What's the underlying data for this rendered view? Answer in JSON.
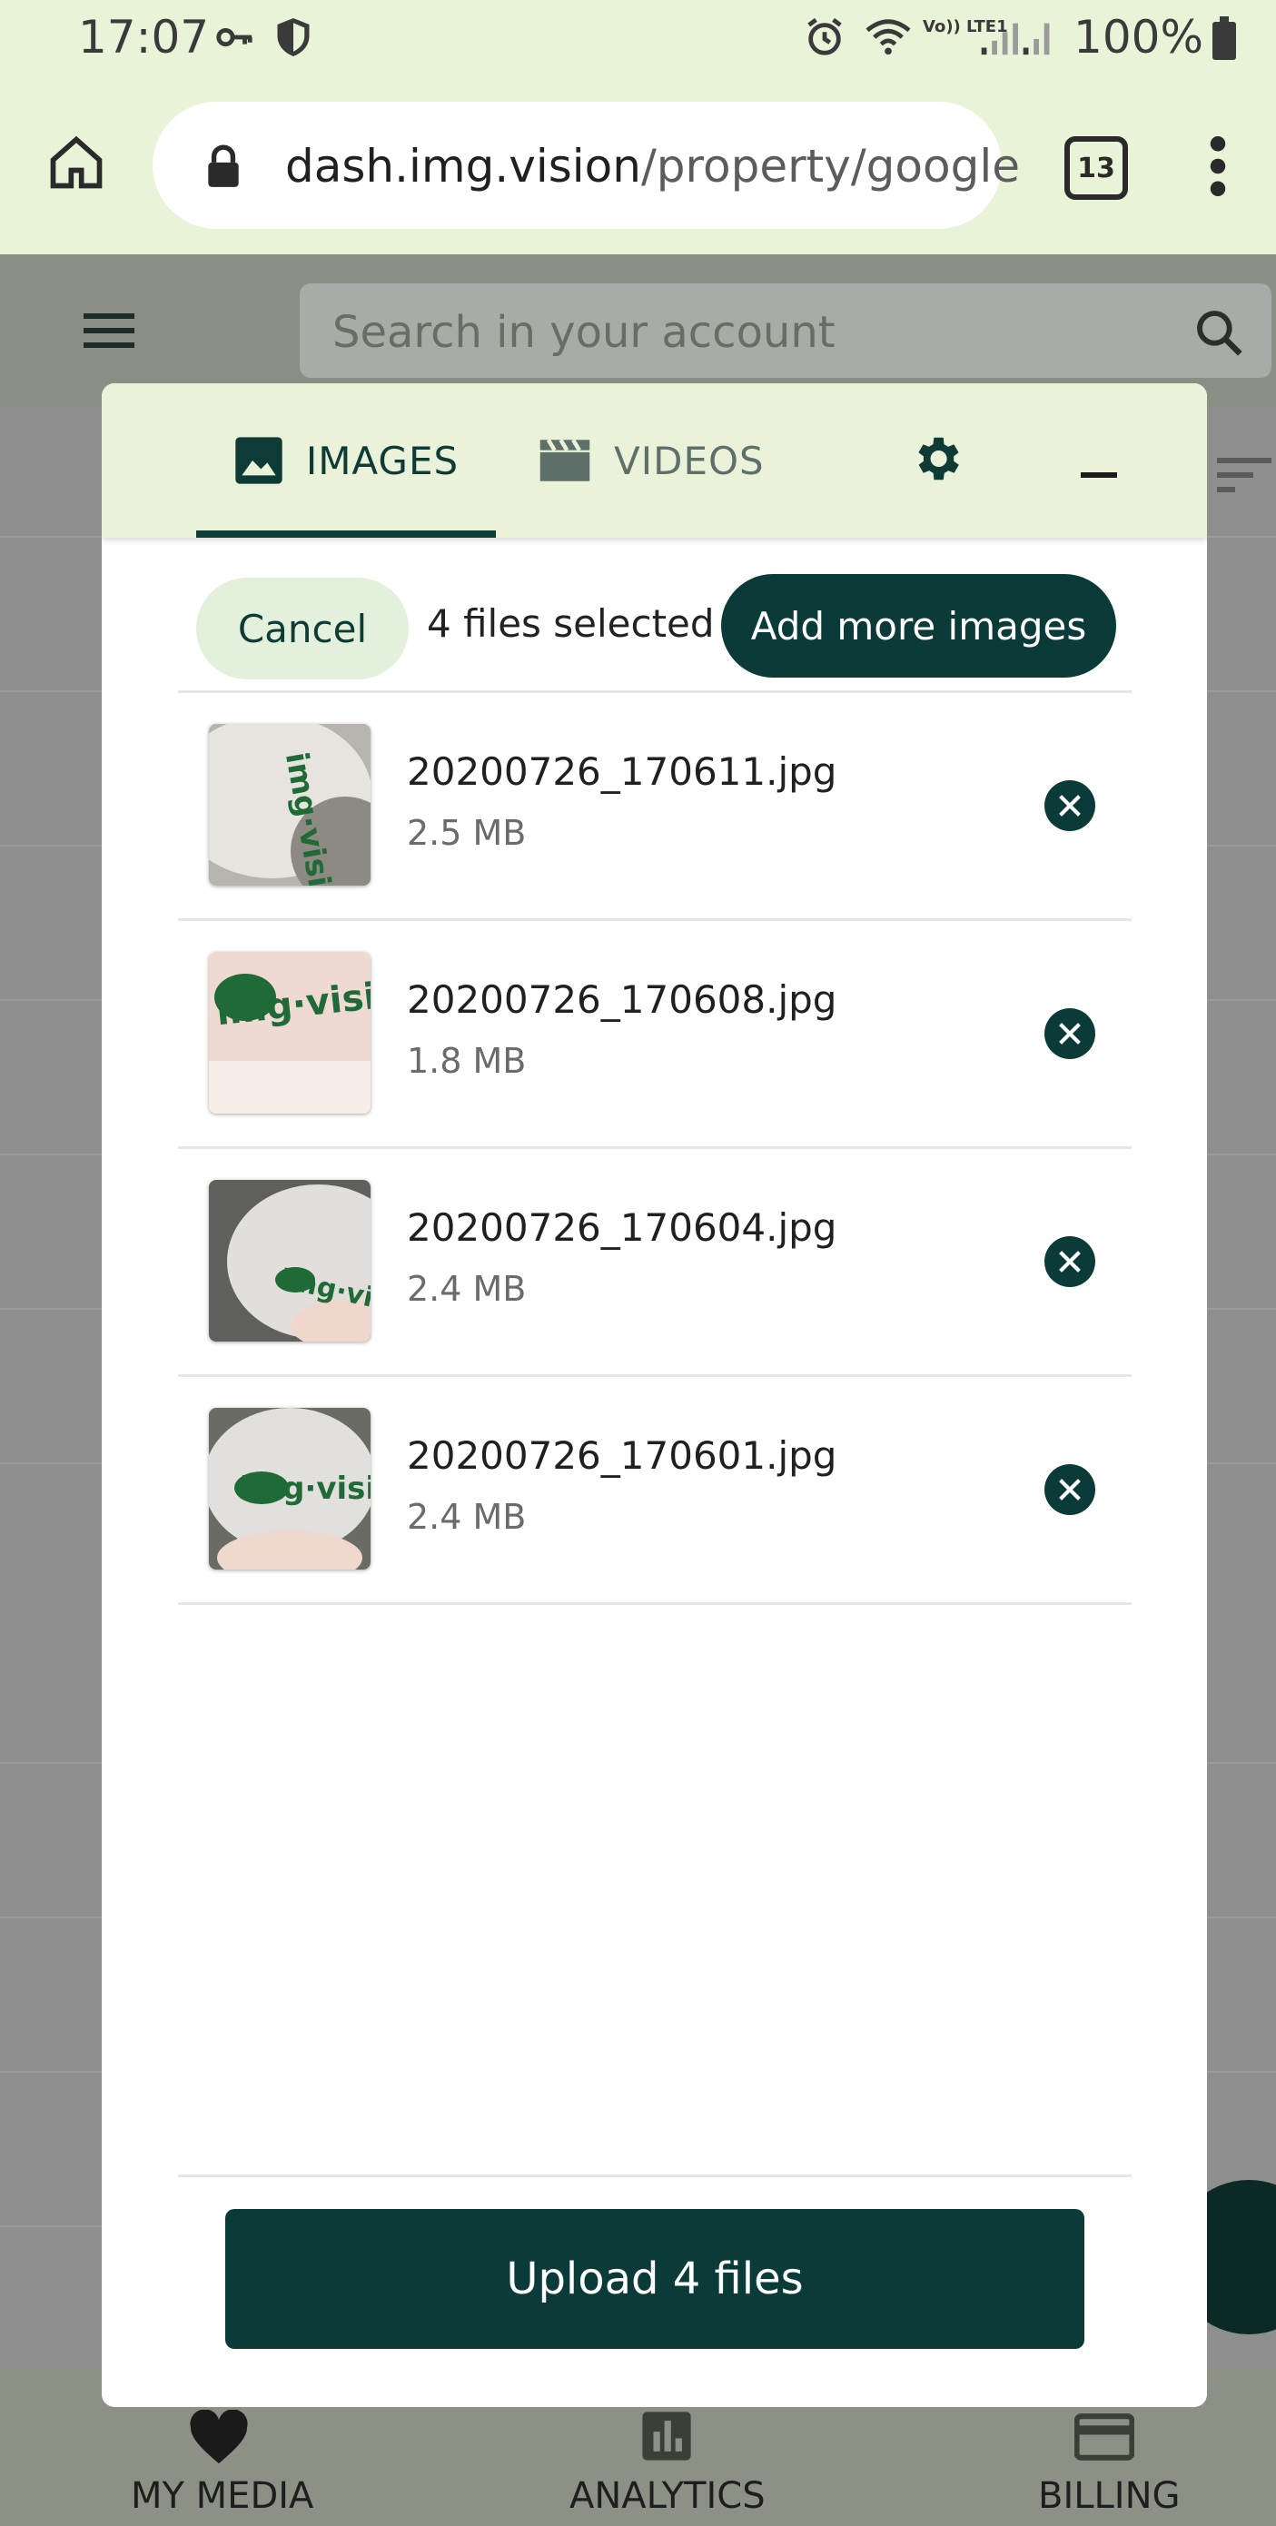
{
  "status_bar": {
    "time": "17:07",
    "battery": "100%",
    "network_label": "Vo)) LTE1",
    "icons": [
      "key-icon",
      "shield-icon",
      "alarm-icon",
      "wifi-icon",
      "signal-icon",
      "battery-icon"
    ]
  },
  "browser": {
    "url_host": "dash.img.vision",
    "url_path": "/property/google",
    "tab_count": "13",
    "icons": [
      "home-icon",
      "lock-icon",
      "tabs-icon",
      "more-vert-icon"
    ]
  },
  "app": {
    "search_placeholder": "Search in your account",
    "bottom_nav": [
      {
        "label": "MY MEDIA",
        "icon": "heart-icon"
      },
      {
        "label": "ANALYTICS",
        "icon": "bar-chart-icon"
      },
      {
        "label": "BILLING",
        "icon": "credit-card-icon"
      }
    ]
  },
  "upload_modal": {
    "tabs": [
      {
        "label": "IMAGES",
        "icon": "image-icon",
        "active": true
      },
      {
        "label": "VIDEOS",
        "icon": "movie-icon",
        "active": false
      }
    ],
    "cancel_label": "Cancel",
    "selected_text": "4 files selected",
    "add_more_label": "Add more images",
    "files": [
      {
        "name": "20200726_170611.jpg",
        "size": "2.5 MB"
      },
      {
        "name": "20200726_170608.jpg",
        "size": "1.8 MB"
      },
      {
        "name": "20200726_170604.jpg",
        "size": "2.4 MB"
      },
      {
        "name": "20200726_170601.jpg",
        "size": "2.4 MB"
      }
    ],
    "upload_label": "Upload 4 files"
  },
  "colors": {
    "accent_dark": "#0b3b38",
    "tab_bar": "#eaf3d9",
    "cancel_bg": "#e3f1dc"
  }
}
